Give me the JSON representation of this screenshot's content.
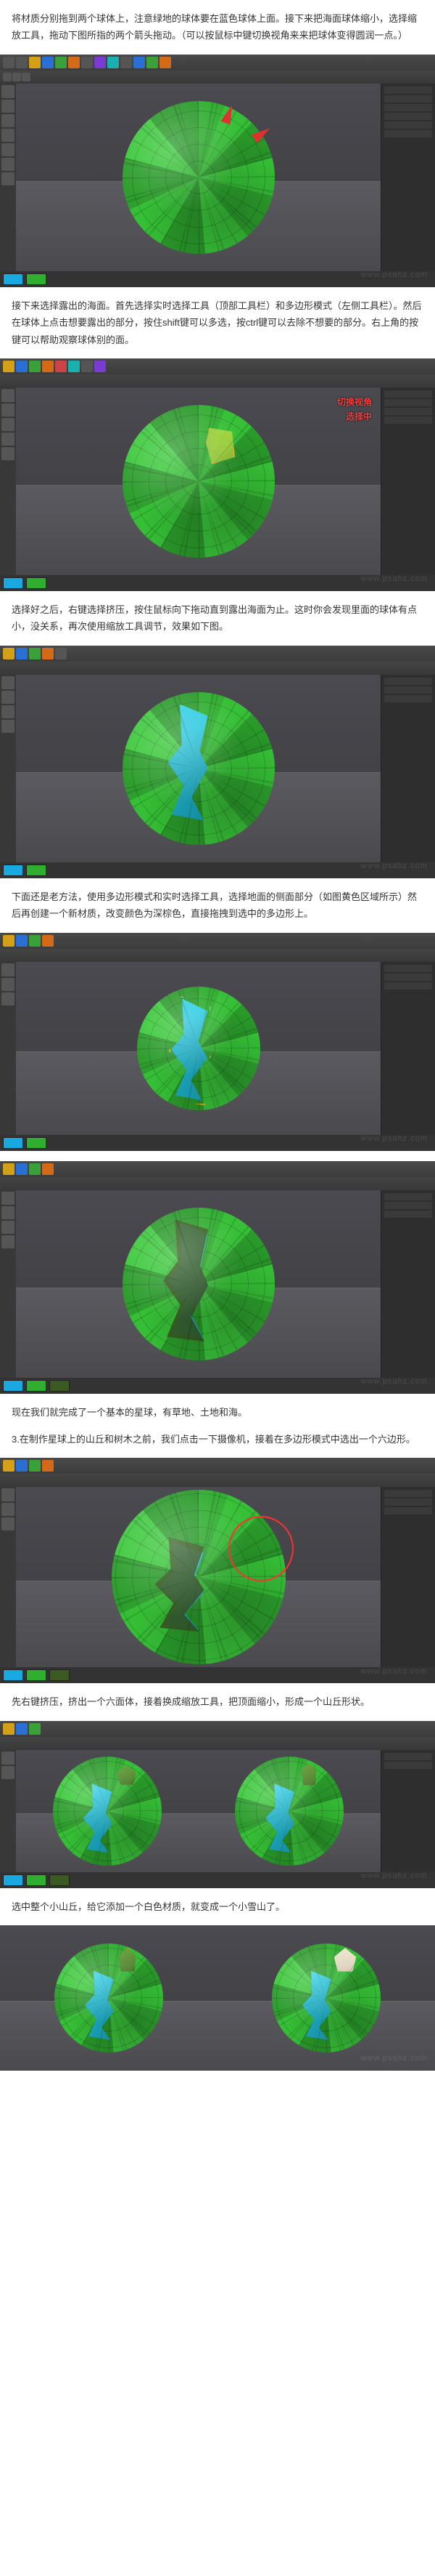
{
  "paragraphs": {
    "p1": "将材质分别拖到两个球体上，注意绿地的球体要在蓝色球体上面。接下来把海面球体缩小，选择缩放工具，拖动下图所指的两个箭头拖动。（可以按鼠标中键切换视角来来把球体变得圆润一点。）",
    "p2": "接下来选择露出的海面。首先选择实时选择工具（顶部工具栏）和多边形模式（左侧工具栏）。然后在球体上点击想要露出的部分，按住shift键可以多选，按ctrl键可以去除不想要的部分。右上角的按键可以帮助观察球体别的面。",
    "p3": "选择好之后，右键选择挤压，按住鼠标向下拖动直到露出海面为止。这时你会发现里面的球体有点小，没关系，再次使用缩放工具调节，效果如下图。",
    "p4": "下面还是老方法，使用多边形模式和实时选择工具，选择地面的侧面部分（如图黄色区域所示）然后再创建一个新材质，改变颜色为深棕色，直接拖拽到选中的多边形上。",
    "p5": "现在我们就完成了一个基本的星球，有草地、土地和海。",
    "p6": "3.在制作星球上的山丘和树木之前，我们点击一下摄像机，接着在多边形模式中选出一个六边形。",
    "p7": "先右键挤压，挤出一个六面体，接着换成缩放工具，把顶面缩小，形成一个山丘形状。",
    "p8": "选中整个小山丘，给它添加一个白色材质，就变成一个小雪山了。"
  },
  "annotations": {
    "img2_a": "切换视角",
    "img2_b": "选择中"
  },
  "swatches": {
    "blue": "#1aa8e0",
    "green": "#2fae2f",
    "darkland": "#3a5a22",
    "snow": "#f0e6d0"
  },
  "watermark": "www.psahz.com"
}
